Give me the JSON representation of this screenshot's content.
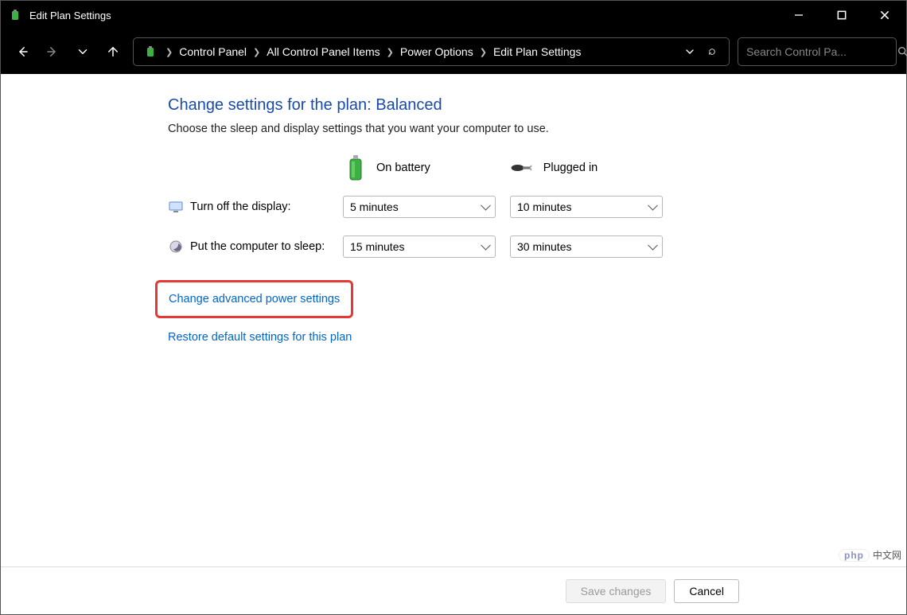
{
  "window": {
    "title": "Edit Plan Settings"
  },
  "breadcrumbs": {
    "items": [
      "Control Panel",
      "All Control Panel Items",
      "Power Options",
      "Edit Plan Settings"
    ]
  },
  "search": {
    "placeholder": "Search Control Pa..."
  },
  "page": {
    "title": "Change settings for the plan: Balanced",
    "subtitle": "Choose the sleep and display settings that you want your computer to use."
  },
  "columns": {
    "battery": "On battery",
    "plugged": "Plugged in"
  },
  "rows": {
    "display": {
      "label": "Turn off the display:",
      "battery_value": "5 minutes",
      "plugged_value": "10 minutes"
    },
    "sleep": {
      "label": "Put the computer to sleep:",
      "battery_value": "15 minutes",
      "plugged_value": "30 minutes"
    }
  },
  "links": {
    "advanced": "Change advanced power settings",
    "restore": "Restore default settings for this plan"
  },
  "buttons": {
    "save": "Save changes",
    "cancel": "Cancel"
  },
  "watermark": {
    "badge": "php",
    "text": "中文网"
  }
}
